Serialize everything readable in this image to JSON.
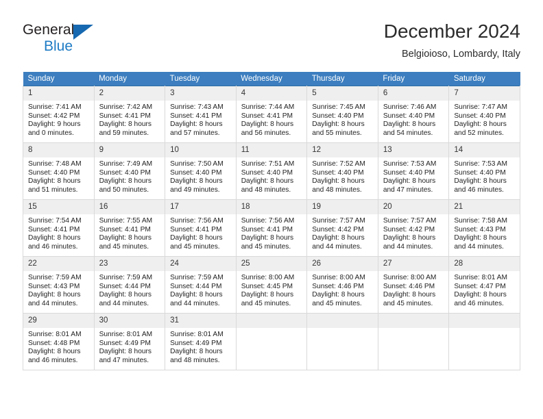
{
  "brand": {
    "line1": "General",
    "line2": "Blue",
    "triangle_color": "#1668b0",
    "text_color": "#231f20",
    "accent_color": "#1e7bc4"
  },
  "header": {
    "title": "December 2024",
    "location": "Belgioioso, Lombardy, Italy"
  },
  "theme": {
    "header_bg": "#3c7ebf",
    "header_text": "#ffffff",
    "daynum_bg": "#efefef",
    "grid_border": "#d9d9d9",
    "week_border": "#2b6ca3"
  },
  "calendar": {
    "weekday_headers": [
      "Sunday",
      "Monday",
      "Tuesday",
      "Wednesday",
      "Thursday",
      "Friday",
      "Saturday"
    ],
    "weeks": [
      [
        {
          "day": "1",
          "sunrise": "Sunrise: 7:41 AM",
          "sunset": "Sunset: 4:42 PM",
          "daylight_1": "Daylight: 9 hours",
          "daylight_2": "and 0 minutes."
        },
        {
          "day": "2",
          "sunrise": "Sunrise: 7:42 AM",
          "sunset": "Sunset: 4:41 PM",
          "daylight_1": "Daylight: 8 hours",
          "daylight_2": "and 59 minutes."
        },
        {
          "day": "3",
          "sunrise": "Sunrise: 7:43 AM",
          "sunset": "Sunset: 4:41 PM",
          "daylight_1": "Daylight: 8 hours",
          "daylight_2": "and 57 minutes."
        },
        {
          "day": "4",
          "sunrise": "Sunrise: 7:44 AM",
          "sunset": "Sunset: 4:41 PM",
          "daylight_1": "Daylight: 8 hours",
          "daylight_2": "and 56 minutes."
        },
        {
          "day": "5",
          "sunrise": "Sunrise: 7:45 AM",
          "sunset": "Sunset: 4:40 PM",
          "daylight_1": "Daylight: 8 hours",
          "daylight_2": "and 55 minutes."
        },
        {
          "day": "6",
          "sunrise": "Sunrise: 7:46 AM",
          "sunset": "Sunset: 4:40 PM",
          "daylight_1": "Daylight: 8 hours",
          "daylight_2": "and 54 minutes."
        },
        {
          "day": "7",
          "sunrise": "Sunrise: 7:47 AM",
          "sunset": "Sunset: 4:40 PM",
          "daylight_1": "Daylight: 8 hours",
          "daylight_2": "and 52 minutes."
        }
      ],
      [
        {
          "day": "8",
          "sunrise": "Sunrise: 7:48 AM",
          "sunset": "Sunset: 4:40 PM",
          "daylight_1": "Daylight: 8 hours",
          "daylight_2": "and 51 minutes."
        },
        {
          "day": "9",
          "sunrise": "Sunrise: 7:49 AM",
          "sunset": "Sunset: 4:40 PM",
          "daylight_1": "Daylight: 8 hours",
          "daylight_2": "and 50 minutes."
        },
        {
          "day": "10",
          "sunrise": "Sunrise: 7:50 AM",
          "sunset": "Sunset: 4:40 PM",
          "daylight_1": "Daylight: 8 hours",
          "daylight_2": "and 49 minutes."
        },
        {
          "day": "11",
          "sunrise": "Sunrise: 7:51 AM",
          "sunset": "Sunset: 4:40 PM",
          "daylight_1": "Daylight: 8 hours",
          "daylight_2": "and 48 minutes."
        },
        {
          "day": "12",
          "sunrise": "Sunrise: 7:52 AM",
          "sunset": "Sunset: 4:40 PM",
          "daylight_1": "Daylight: 8 hours",
          "daylight_2": "and 48 minutes."
        },
        {
          "day": "13",
          "sunrise": "Sunrise: 7:53 AM",
          "sunset": "Sunset: 4:40 PM",
          "daylight_1": "Daylight: 8 hours",
          "daylight_2": "and 47 minutes."
        },
        {
          "day": "14",
          "sunrise": "Sunrise: 7:53 AM",
          "sunset": "Sunset: 4:40 PM",
          "daylight_1": "Daylight: 8 hours",
          "daylight_2": "and 46 minutes."
        }
      ],
      [
        {
          "day": "15",
          "sunrise": "Sunrise: 7:54 AM",
          "sunset": "Sunset: 4:41 PM",
          "daylight_1": "Daylight: 8 hours",
          "daylight_2": "and 46 minutes."
        },
        {
          "day": "16",
          "sunrise": "Sunrise: 7:55 AM",
          "sunset": "Sunset: 4:41 PM",
          "daylight_1": "Daylight: 8 hours",
          "daylight_2": "and 45 minutes."
        },
        {
          "day": "17",
          "sunrise": "Sunrise: 7:56 AM",
          "sunset": "Sunset: 4:41 PM",
          "daylight_1": "Daylight: 8 hours",
          "daylight_2": "and 45 minutes."
        },
        {
          "day": "18",
          "sunrise": "Sunrise: 7:56 AM",
          "sunset": "Sunset: 4:41 PM",
          "daylight_1": "Daylight: 8 hours",
          "daylight_2": "and 45 minutes."
        },
        {
          "day": "19",
          "sunrise": "Sunrise: 7:57 AM",
          "sunset": "Sunset: 4:42 PM",
          "daylight_1": "Daylight: 8 hours",
          "daylight_2": "and 44 minutes."
        },
        {
          "day": "20",
          "sunrise": "Sunrise: 7:57 AM",
          "sunset": "Sunset: 4:42 PM",
          "daylight_1": "Daylight: 8 hours",
          "daylight_2": "and 44 minutes."
        },
        {
          "day": "21",
          "sunrise": "Sunrise: 7:58 AM",
          "sunset": "Sunset: 4:43 PM",
          "daylight_1": "Daylight: 8 hours",
          "daylight_2": "and 44 minutes."
        }
      ],
      [
        {
          "day": "22",
          "sunrise": "Sunrise: 7:59 AM",
          "sunset": "Sunset: 4:43 PM",
          "daylight_1": "Daylight: 8 hours",
          "daylight_2": "and 44 minutes."
        },
        {
          "day": "23",
          "sunrise": "Sunrise: 7:59 AM",
          "sunset": "Sunset: 4:44 PM",
          "daylight_1": "Daylight: 8 hours",
          "daylight_2": "and 44 minutes."
        },
        {
          "day": "24",
          "sunrise": "Sunrise: 7:59 AM",
          "sunset": "Sunset: 4:44 PM",
          "daylight_1": "Daylight: 8 hours",
          "daylight_2": "and 44 minutes."
        },
        {
          "day": "25",
          "sunrise": "Sunrise: 8:00 AM",
          "sunset": "Sunset: 4:45 PM",
          "daylight_1": "Daylight: 8 hours",
          "daylight_2": "and 45 minutes."
        },
        {
          "day": "26",
          "sunrise": "Sunrise: 8:00 AM",
          "sunset": "Sunset: 4:46 PM",
          "daylight_1": "Daylight: 8 hours",
          "daylight_2": "and 45 minutes."
        },
        {
          "day": "27",
          "sunrise": "Sunrise: 8:00 AM",
          "sunset": "Sunset: 4:46 PM",
          "daylight_1": "Daylight: 8 hours",
          "daylight_2": "and 45 minutes."
        },
        {
          "day": "28",
          "sunrise": "Sunrise: 8:01 AM",
          "sunset": "Sunset: 4:47 PM",
          "daylight_1": "Daylight: 8 hours",
          "daylight_2": "and 46 minutes."
        }
      ],
      [
        {
          "day": "29",
          "sunrise": "Sunrise: 8:01 AM",
          "sunset": "Sunset: 4:48 PM",
          "daylight_1": "Daylight: 8 hours",
          "daylight_2": "and 46 minutes."
        },
        {
          "day": "30",
          "sunrise": "Sunrise: 8:01 AM",
          "sunset": "Sunset: 4:49 PM",
          "daylight_1": "Daylight: 8 hours",
          "daylight_2": "and 47 minutes."
        },
        {
          "day": "31",
          "sunrise": "Sunrise: 8:01 AM",
          "sunset": "Sunset: 4:49 PM",
          "daylight_1": "Daylight: 8 hours",
          "daylight_2": "and 48 minutes."
        },
        {
          "day": "",
          "sunrise": "",
          "sunset": "",
          "daylight_1": "",
          "daylight_2": ""
        },
        {
          "day": "",
          "sunrise": "",
          "sunset": "",
          "daylight_1": "",
          "daylight_2": ""
        },
        {
          "day": "",
          "sunrise": "",
          "sunset": "",
          "daylight_1": "",
          "daylight_2": ""
        },
        {
          "day": "",
          "sunrise": "",
          "sunset": "",
          "daylight_1": "",
          "daylight_2": ""
        }
      ]
    ]
  }
}
